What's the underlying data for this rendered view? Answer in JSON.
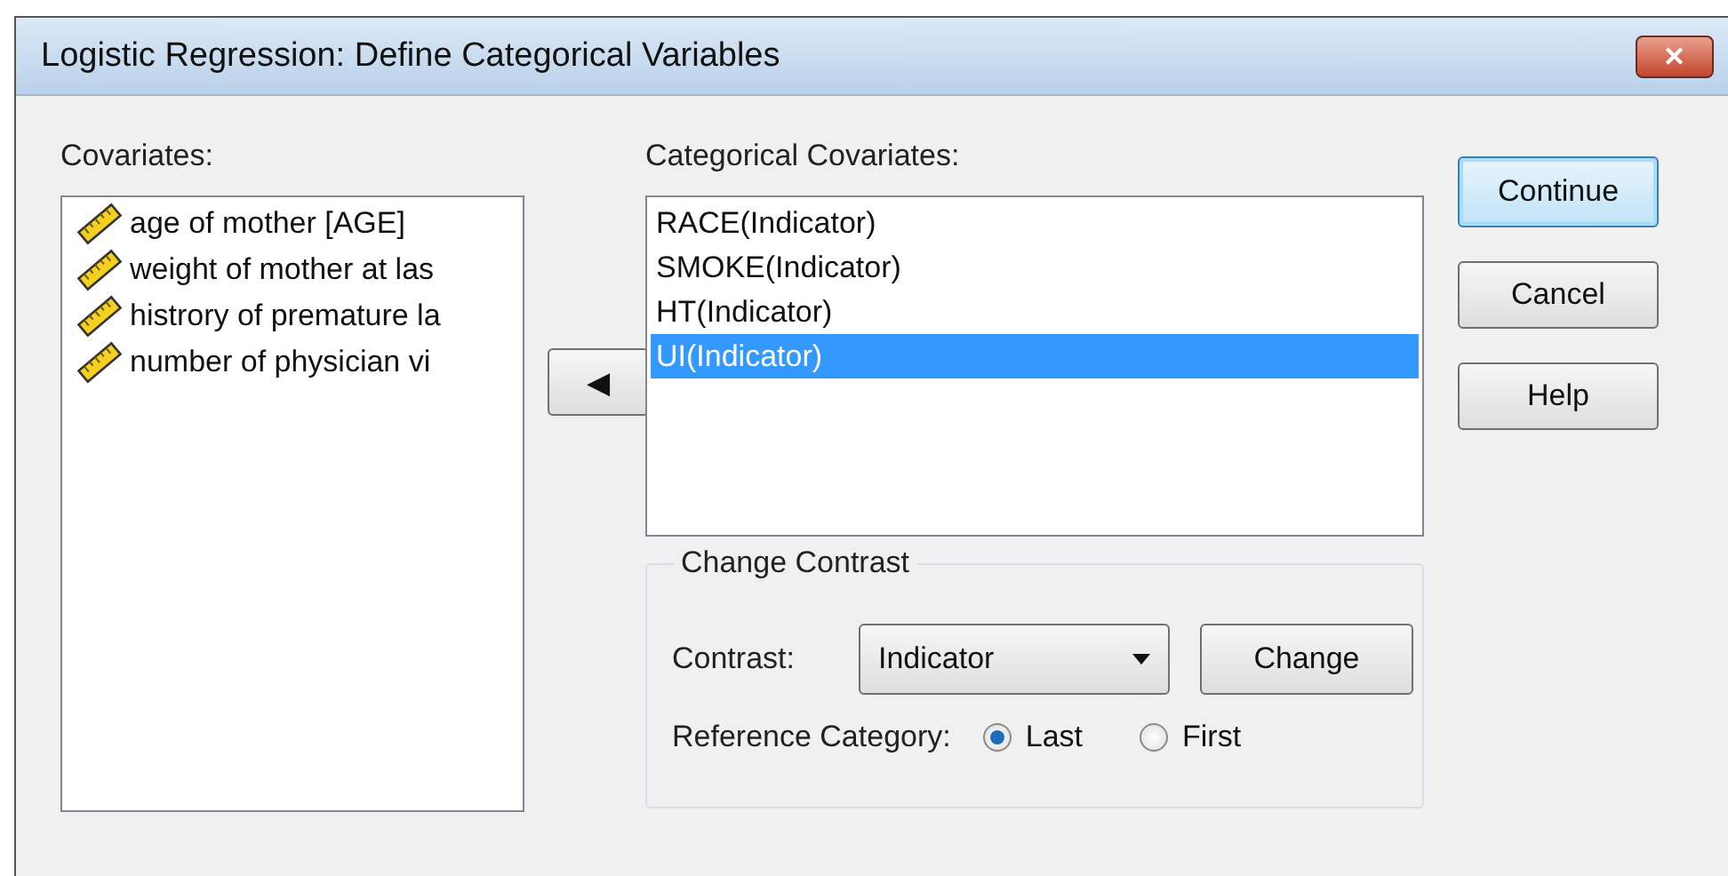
{
  "window": {
    "title": "Logistic Regression: Define Categorical Variables",
    "close_label": "✕"
  },
  "covariates": {
    "label": "Covariates:",
    "items": [
      {
        "label": "age of mother [AGE]"
      },
      {
        "label": "weight of mother at las"
      },
      {
        "label": "histrory of premature la"
      },
      {
        "label": "number of physician vi"
      }
    ]
  },
  "move_button": {
    "glyph": "◀"
  },
  "categorical": {
    "label": "Categorical Covariates:",
    "items": [
      {
        "label": "RACE(Indicator)",
        "selected": false
      },
      {
        "label": "SMOKE(Indicator)",
        "selected": false
      },
      {
        "label": "HT(Indicator)",
        "selected": false
      },
      {
        "label": "UI(Indicator)",
        "selected": true
      }
    ]
  },
  "change_contrast": {
    "title": "Change Contrast",
    "contrast_label": "Contrast:",
    "contrast_value": "Indicator",
    "change_button": "Change",
    "reference_label": "Reference Category:",
    "reference_options": [
      {
        "label": "Last",
        "selected": true
      },
      {
        "label": "First",
        "selected": false
      }
    ]
  },
  "buttons": [
    {
      "label": "Continue",
      "default": true
    },
    {
      "label": "Cancel",
      "default": false
    },
    {
      "label": "Help",
      "default": false
    }
  ]
}
